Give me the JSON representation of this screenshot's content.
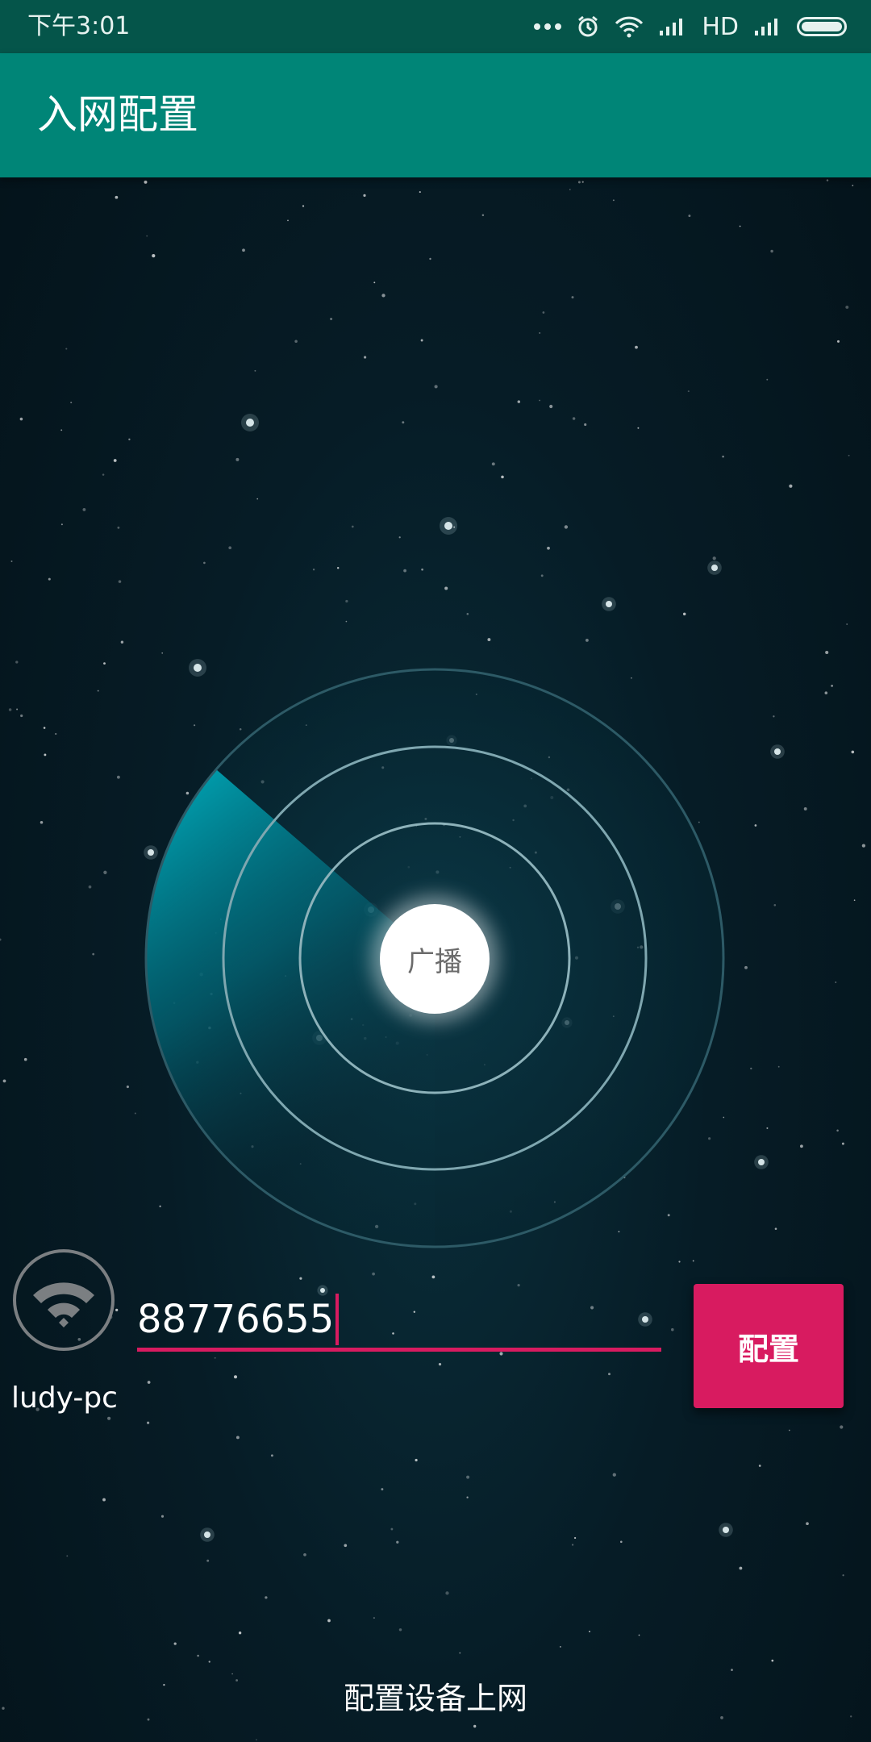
{
  "status_bar": {
    "time": "下午3:01",
    "network": "HD",
    "icons": [
      "more-dots-icon",
      "alarm-icon",
      "wifi-signal-icon",
      "cell-signal-icon",
      "cell-signal-icon-2",
      "battery-icon"
    ]
  },
  "app_bar": {
    "title": "入网配置"
  },
  "radar": {
    "center_label": "广播"
  },
  "wifi": {
    "ssid": "ludy-pc",
    "icon": "wifi-icon"
  },
  "password": {
    "value": "88776655"
  },
  "actions": {
    "config_label": "配置"
  },
  "footer": {
    "text": "配置设备上网"
  },
  "colors": {
    "status_bar": "#05554a",
    "app_bar": "#008577",
    "accent": "#d81b60",
    "background": "#061c26",
    "radar_sweep": "#00a0b0"
  }
}
